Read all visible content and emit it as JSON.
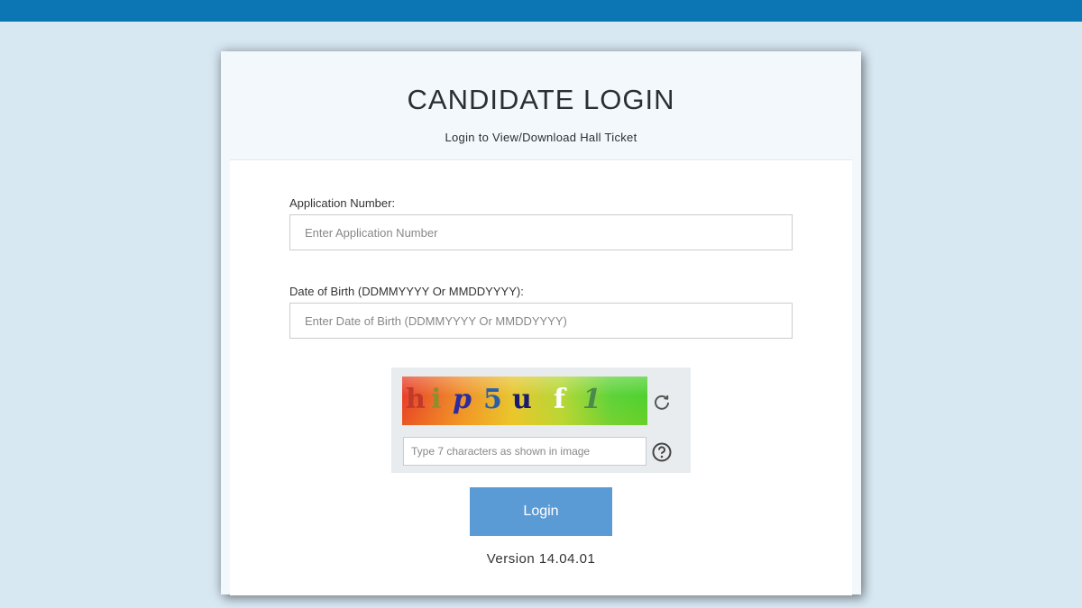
{
  "header": {
    "title": "CANDIDATE LOGIN",
    "subtitle": "Login to View/Download Hall Ticket"
  },
  "form": {
    "application_number": {
      "label": "Application Number:",
      "placeholder": "Enter Application Number",
      "value": ""
    },
    "date_of_birth": {
      "label": "Date of Birth (DDMMYYYY Or MMDDYYYY):",
      "placeholder": "Enter Date of Birth (DDMMYYYY Or MMDDYYYY)",
      "value": ""
    },
    "captcha": {
      "characters": [
        {
          "char": "h",
          "color": "#c0392b"
        },
        {
          "char": "i",
          "color": "#8e8e2e"
        },
        {
          "char": "p",
          "color": "#2c2c9e"
        },
        {
          "char": "5",
          "color": "#2a5fa8"
        },
        {
          "char": "u",
          "color": "#1a1a6e"
        },
        {
          "char": "f",
          "color": "#ffffff"
        },
        {
          "char": "1",
          "color": "#4a8a4a"
        }
      ],
      "input_placeholder": "Type 7 characters as shown in image",
      "refresh_icon": "refresh-icon",
      "help_icon": "help-icon"
    },
    "login_label": "Login"
  },
  "footer": {
    "version": "Version 14.04.01"
  },
  "colors": {
    "top_bar": "#0b76b3",
    "page_background": "#d8e8f3",
    "login_button": "#5b9bd5"
  }
}
